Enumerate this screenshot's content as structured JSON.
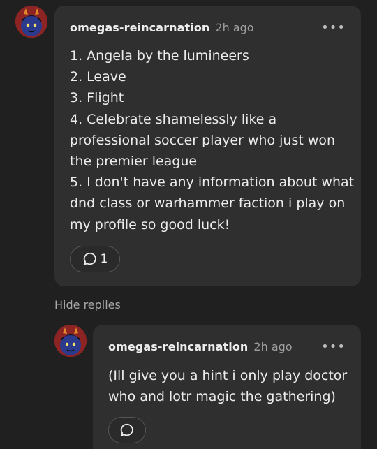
{
  "comment": {
    "username": "omegas-reincarnation",
    "timestamp": "2h ago",
    "more_icon": "more-horizontal-icon",
    "body_lines": [
      "1. Angela by the lumineers",
      "2. Leave",
      "3. Flight",
      "4. Celebrate shamelessly like a",
      "professional soccer player who just won",
      "the premier league",
      "5. I don't have any information about what",
      "dnd class or warhammer faction i play on",
      "my profile so good luck!"
    ],
    "reply_count": "1",
    "reply_icon": "speech-bubble-icon"
  },
  "thread": {
    "hide_replies_label": "Hide replies"
  },
  "reply": {
    "username": "omegas-reincarnation",
    "timestamp": "2h ago",
    "more_icon": "more-horizontal-icon",
    "body_lines": [
      "(Ill give you a hint i only play doctor",
      "who and lotr magic the gathering)"
    ],
    "reply_icon": "speech-bubble-icon"
  },
  "colors": {
    "background": "#202020",
    "card": "#2f2f2f",
    "text": "#ececec",
    "muted": "#a0a0a0"
  }
}
